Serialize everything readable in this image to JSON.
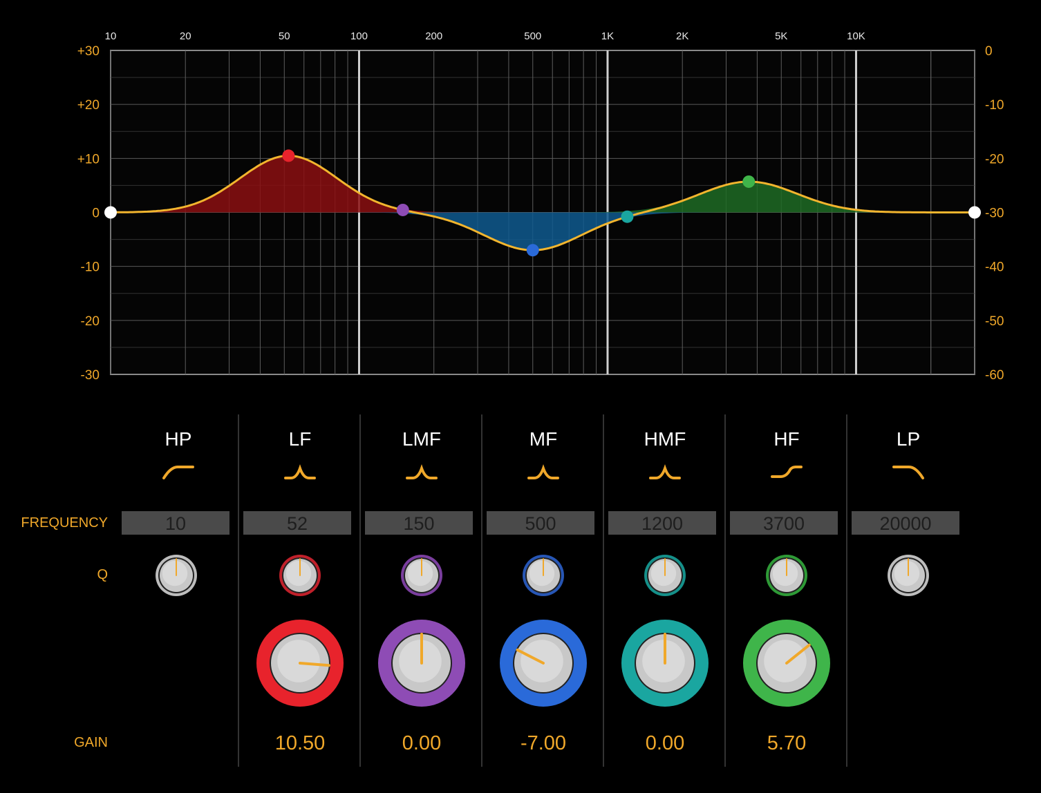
{
  "graph": {
    "x_ticks": [
      "10",
      "20",
      "50",
      "100",
      "200",
      "500",
      "1K",
      "2K",
      "5K",
      "10K"
    ],
    "left_ticks": [
      "+30",
      "+20",
      "+10",
      "0",
      "-10",
      "-20",
      "-30"
    ],
    "right_ticks": [
      "0",
      "-10",
      "-20",
      "-30",
      "-40",
      "-50",
      "-60"
    ],
    "curve_color": "#f2b52e"
  },
  "rows": {
    "frequency_label": "FREQUENCY",
    "q_label": "Q",
    "gain_label": "GAIN"
  },
  "bands": [
    {
      "name": "HP",
      "shape": "highpass-icon",
      "frequency": "10",
      "q_ring": "#bdbdbd",
      "q_angle": 0,
      "has_gain": false,
      "gain": null,
      "color": "#ffffff"
    },
    {
      "name": "LF",
      "shape": "peak-icon",
      "frequency": "52",
      "q_ring": "#c0202a",
      "q_angle": 0,
      "has_gain": true,
      "gain": "10.50",
      "gain_num": 10.5,
      "color": "#e8232c",
      "fill": "#8b0f12"
    },
    {
      "name": "LMF",
      "shape": "peak-icon",
      "frequency": "150",
      "q_ring": "#7a3e9e",
      "q_angle": 0,
      "has_gain": true,
      "gain": "0.00",
      "gain_num": 0,
      "color": "#8e4cb5",
      "fill": "#5a2a7a"
    },
    {
      "name": "MF",
      "shape": "peak-icon",
      "frequency": "500",
      "q_ring": "#2756b5",
      "q_angle": 0,
      "has_gain": true,
      "gain": "-7.00",
      "gain_num": -7,
      "color": "#2a6ad9",
      "fill": "#0f5a8f"
    },
    {
      "name": "HMF",
      "shape": "peak-icon",
      "frequency": "1200",
      "q_ring": "#15908a",
      "q_angle": 0,
      "has_gain": true,
      "gain": "0.00",
      "gain_num": 0,
      "color": "#1aa6a0",
      "fill": "#0f6d6a"
    },
    {
      "name": "HF",
      "shape": "shelf-icon",
      "frequency": "3700",
      "q_ring": "#2e9a36",
      "q_angle": 0,
      "has_gain": true,
      "gain": "5.70",
      "gain_num": 5.7,
      "color": "#3fb54a",
      "fill": "#1f6b24"
    },
    {
      "name": "LP",
      "shape": "lowpass-icon",
      "frequency": "20000",
      "q_ring": "#bdbdbd",
      "q_angle": 0,
      "has_gain": false,
      "gain": null,
      "color": "#ffffff"
    }
  ]
}
